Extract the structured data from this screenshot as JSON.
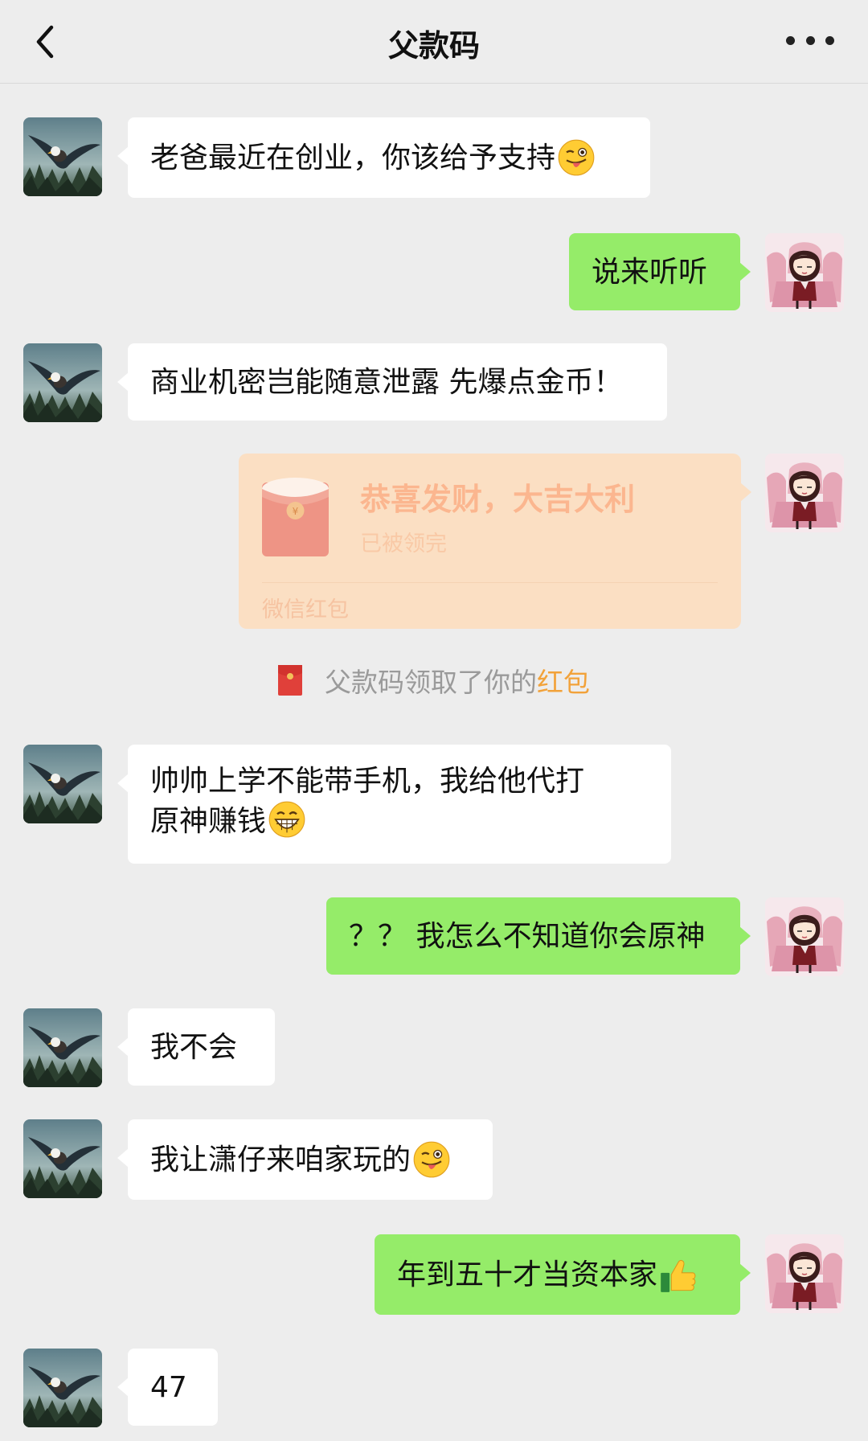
{
  "header": {
    "title": "父款码"
  },
  "messages": [
    {
      "text": "老爸最近在创业，你该给予支持"
    },
    {
      "text": "说来听听"
    },
    {
      "text": "商业机密岂能随意泄露 先爆点金币！"
    },
    {
      "redpacket": {
        "title": "恭喜发财，大吉大利",
        "status": "已被领完",
        "footer": "微信红包"
      }
    },
    {
      "system": {
        "prefix": "父款码领取了你的",
        "highlight": "红包"
      }
    },
    {
      "text": "帅帅上学不能带手机，我给他代打原神赚钱"
    },
    {
      "text": "？？ 我怎么不知道你会原神"
    },
    {
      "text": "我不会"
    },
    {
      "text": "我让潇仔来咱家玩的"
    },
    {
      "text": "年到五十才当资本家"
    },
    {
      "text": "47"
    }
  ],
  "colors": {
    "incoming": "#ffffff",
    "outgoing": "#95ec69",
    "redpacket": "#fbdfc3",
    "highlight": "#f2a23a"
  },
  "icons": [
    "back-chevron-icon",
    "more-dots-icon",
    "winking-tongue-emoji",
    "grinning-emoji",
    "thumbs-up-emoji",
    "red-packet-icon"
  ]
}
